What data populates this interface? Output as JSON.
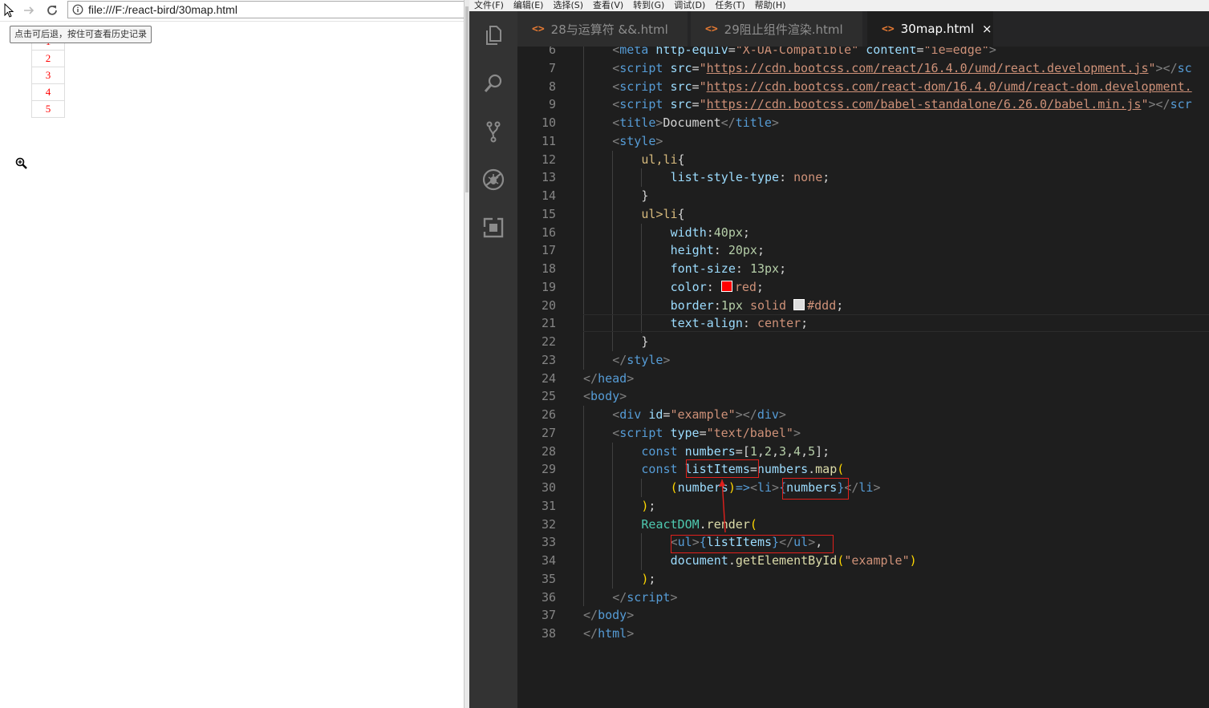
{
  "browser": {
    "url": "file:///F:/react-bird/30map.html",
    "back_tooltip": "点击可后退，按住可查看历史记录",
    "list_items": [
      "1",
      "2",
      "3",
      "4",
      "5"
    ]
  },
  "editor": {
    "menu": [
      "文件(F)",
      "编辑(E)",
      "选择(S)",
      "查看(V)",
      "转到(G)",
      "调试(D)",
      "任务(T)",
      "帮助(H)"
    ],
    "tabs": [
      {
        "label": "28与运算符 &&.html",
        "active": false
      },
      {
        "label": "29阻止组件渲染.html",
        "active": false
      },
      {
        "label": "30map.html",
        "active": true
      }
    ],
    "tab_close": "×",
    "activity_icons": [
      "explorer-icon",
      "search-icon",
      "source-control-icon",
      "debug-icon",
      "extensions-icon"
    ],
    "swatch_colors": {
      "red": "#ff0000",
      "ddd": "#dddddd"
    },
    "lines": [
      {
        "n": "6",
        "indent": 1,
        "tokens": [
          [
            "t-br",
            "<"
          ],
          [
            "t-tag",
            "meta"
          ],
          [
            "t-plain",
            " "
          ],
          [
            "t-attr",
            "http-equiv"
          ],
          [
            "t-plain",
            "="
          ],
          [
            "t-str",
            "\"X-UA-Compatible\""
          ],
          [
            "t-plain",
            " "
          ],
          [
            "t-attr",
            "content"
          ],
          [
            "t-plain",
            "="
          ],
          [
            "t-str",
            "\"ie=edge\""
          ],
          [
            "t-br",
            ">"
          ]
        ]
      },
      {
        "n": "7",
        "indent": 1,
        "tokens": [
          [
            "t-br",
            "<"
          ],
          [
            "t-tag",
            "script"
          ],
          [
            "t-plain",
            " "
          ],
          [
            "t-attr",
            "src"
          ],
          [
            "t-plain",
            "="
          ],
          [
            "t-str",
            "\""
          ],
          [
            "t-url",
            "https://cdn.bootcss.com/react/16.4.0/umd/react.development.js"
          ],
          [
            "t-str",
            "\""
          ],
          [
            "t-br",
            "></"
          ],
          [
            "t-tag",
            "sc"
          ]
        ]
      },
      {
        "n": "8",
        "indent": 1,
        "tokens": [
          [
            "t-br",
            "<"
          ],
          [
            "t-tag",
            "script"
          ],
          [
            "t-plain",
            " "
          ],
          [
            "t-attr",
            "src"
          ],
          [
            "t-plain",
            "="
          ],
          [
            "t-str",
            "\""
          ],
          [
            "t-url",
            "https://cdn.bootcss.com/react-dom/16.4.0/umd/react-dom.development."
          ]
        ]
      },
      {
        "n": "9",
        "indent": 1,
        "tokens": [
          [
            "t-br",
            "<"
          ],
          [
            "t-tag",
            "script"
          ],
          [
            "t-plain",
            " "
          ],
          [
            "t-attr",
            "src"
          ],
          [
            "t-plain",
            "="
          ],
          [
            "t-str",
            "\""
          ],
          [
            "t-url",
            "https://cdn.bootcss.com/babel-standalone/6.26.0/babel.min.js"
          ],
          [
            "t-str",
            "\""
          ],
          [
            "t-br",
            "></"
          ],
          [
            "t-tag",
            "scr"
          ]
        ]
      },
      {
        "n": "10",
        "indent": 1,
        "tokens": [
          [
            "t-br",
            "<"
          ],
          [
            "t-tag",
            "title"
          ],
          [
            "t-br",
            ">"
          ],
          [
            "t-plain",
            "Document"
          ],
          [
            "t-br",
            "</"
          ],
          [
            "t-tag",
            "title"
          ],
          [
            "t-br",
            ">"
          ]
        ]
      },
      {
        "n": "11",
        "indent": 1,
        "tokens": [
          [
            "t-br",
            "<"
          ],
          [
            "t-tag",
            "style"
          ],
          [
            "t-br",
            ">"
          ]
        ]
      },
      {
        "n": "12",
        "indent": 2,
        "tokens": [
          [
            "t-sel",
            "ul,li"
          ],
          [
            "t-plain",
            "{"
          ]
        ]
      },
      {
        "n": "13",
        "indent": 3,
        "tokens": [
          [
            "t-prop",
            "list-style-type"
          ],
          [
            "t-plain",
            ": "
          ],
          [
            "t-val",
            "none"
          ],
          [
            "t-plain",
            ";"
          ]
        ]
      },
      {
        "n": "14",
        "indent": 2,
        "tokens": [
          [
            "t-plain",
            "}"
          ]
        ]
      },
      {
        "n": "15",
        "indent": 2,
        "tokens": [
          [
            "t-sel",
            "ul>li"
          ],
          [
            "t-plain",
            "{"
          ]
        ]
      },
      {
        "n": "16",
        "indent": 3,
        "tokens": [
          [
            "t-prop",
            "width"
          ],
          [
            "t-plain",
            ":"
          ],
          [
            "t-num",
            "40px"
          ],
          [
            "t-plain",
            ";"
          ]
        ]
      },
      {
        "n": "17",
        "indent": 3,
        "tokens": [
          [
            "t-prop",
            "height"
          ],
          [
            "t-plain",
            ": "
          ],
          [
            "t-num",
            "20px"
          ],
          [
            "t-plain",
            ";"
          ]
        ]
      },
      {
        "n": "18",
        "indent": 3,
        "tokens": [
          [
            "t-prop",
            "font-size"
          ],
          [
            "t-plain",
            ": "
          ],
          [
            "t-num",
            "13px"
          ],
          [
            "t-plain",
            ";"
          ]
        ]
      },
      {
        "n": "19",
        "indent": 3,
        "tokens": [
          [
            "t-prop",
            "color"
          ],
          [
            "t-plain",
            ": "
          ],
          [
            "swatch-red",
            ""
          ],
          [
            "t-val",
            "red"
          ],
          [
            "t-plain",
            ";"
          ]
        ]
      },
      {
        "n": "20",
        "indent": 3,
        "tokens": [
          [
            "t-prop",
            "border"
          ],
          [
            "t-plain",
            ":"
          ],
          [
            "t-num",
            "1px"
          ],
          [
            "t-plain",
            " "
          ],
          [
            "t-val",
            "solid"
          ],
          [
            "t-plain",
            " "
          ],
          [
            "swatch-ddd",
            ""
          ],
          [
            "t-val",
            "#ddd"
          ],
          [
            "t-plain",
            ";"
          ]
        ]
      },
      {
        "n": "21",
        "indent": 3,
        "tokens": [
          [
            "t-prop",
            "text-align"
          ],
          [
            "t-plain",
            ": "
          ],
          [
            "t-val",
            "center"
          ],
          [
            "t-plain",
            ";"
          ]
        ]
      },
      {
        "n": "22",
        "indent": 2,
        "tokens": [
          [
            "t-plain",
            "}"
          ]
        ]
      },
      {
        "n": "23",
        "indent": 1,
        "tokens": [
          [
            "t-br",
            "</"
          ],
          [
            "t-tag",
            "style"
          ],
          [
            "t-br",
            ">"
          ]
        ]
      },
      {
        "n": "24",
        "indent": 0,
        "tokens": [
          [
            "t-br",
            "</"
          ],
          [
            "t-tag",
            "head"
          ],
          [
            "t-br",
            ">"
          ]
        ]
      },
      {
        "n": "25",
        "indent": 0,
        "tokens": [
          [
            "t-br",
            "<"
          ],
          [
            "t-tag",
            "body"
          ],
          [
            "t-br",
            ">"
          ]
        ]
      },
      {
        "n": "26",
        "indent": 1,
        "tokens": [
          [
            "t-br",
            "<"
          ],
          [
            "t-tag",
            "div"
          ],
          [
            "t-plain",
            " "
          ],
          [
            "t-attr",
            "id"
          ],
          [
            "t-plain",
            "="
          ],
          [
            "t-str",
            "\"example\""
          ],
          [
            "t-br",
            "></"
          ],
          [
            "t-tag",
            "div"
          ],
          [
            "t-br",
            ">"
          ]
        ]
      },
      {
        "n": "27",
        "indent": 1,
        "tokens": [
          [
            "t-br",
            "<"
          ],
          [
            "t-tag",
            "script"
          ],
          [
            "t-plain",
            " "
          ],
          [
            "t-attr",
            "type"
          ],
          [
            "t-plain",
            "="
          ],
          [
            "t-str",
            "\"text/babel\""
          ],
          [
            "t-br",
            ">"
          ]
        ]
      },
      {
        "n": "28",
        "indent": 2,
        "tokens": [
          [
            "t-kw",
            "const"
          ],
          [
            "t-plain",
            " "
          ],
          [
            "t-var",
            "numbers"
          ],
          [
            "t-plain",
            "=["
          ],
          [
            "t-num",
            "1"
          ],
          [
            "t-plain",
            ","
          ],
          [
            "t-num",
            "2"
          ],
          [
            "t-plain",
            ","
          ],
          [
            "t-num",
            "3"
          ],
          [
            "t-plain",
            ","
          ],
          [
            "t-num",
            "4"
          ],
          [
            "t-plain",
            ","
          ],
          [
            "t-num",
            "5"
          ],
          [
            "t-plain",
            "];"
          ]
        ]
      },
      {
        "n": "29",
        "indent": 2,
        "tokens": [
          [
            "t-kw",
            "const"
          ],
          [
            "t-plain",
            " "
          ],
          [
            "t-var",
            "listItems"
          ],
          [
            "t-plain",
            "="
          ],
          [
            "t-var",
            "numbers"
          ],
          [
            "t-plain",
            "."
          ],
          [
            "t-fn",
            "map"
          ],
          [
            "t-brace",
            "("
          ]
        ]
      },
      {
        "n": "30",
        "indent": 3,
        "tokens": [
          [
            "t-brace",
            "("
          ],
          [
            "t-var",
            "numbers"
          ],
          [
            "t-brace",
            ")"
          ],
          [
            "t-kw",
            "=>"
          ],
          [
            "t-br",
            "<"
          ],
          [
            "t-tag",
            "li"
          ],
          [
            "t-br",
            ">"
          ],
          [
            "t-kw",
            "{"
          ],
          [
            "t-var",
            "numbers"
          ],
          [
            "t-kw",
            "}"
          ],
          [
            "t-br",
            "</"
          ],
          [
            "t-tag",
            "li"
          ],
          [
            "t-br",
            ">"
          ]
        ]
      },
      {
        "n": "31",
        "indent": 2,
        "tokens": [
          [
            "t-brace",
            ")"
          ],
          [
            "t-plain",
            ";"
          ]
        ]
      },
      {
        "n": "32",
        "indent": 2,
        "tokens": [
          [
            "t-cls",
            "ReactDOM"
          ],
          [
            "t-plain",
            "."
          ],
          [
            "t-fn",
            "render"
          ],
          [
            "t-brace",
            "("
          ]
        ]
      },
      {
        "n": "33",
        "indent": 3,
        "tokens": [
          [
            "t-br",
            "<"
          ],
          [
            "t-tag",
            "ul"
          ],
          [
            "t-br",
            ">"
          ],
          [
            "t-kw",
            "{"
          ],
          [
            "t-var",
            "listItems"
          ],
          [
            "t-kw",
            "}"
          ],
          [
            "t-br",
            "</"
          ],
          [
            "t-tag",
            "ul"
          ],
          [
            "t-br",
            ">"
          ],
          [
            "t-plain",
            ","
          ]
        ]
      },
      {
        "n": "34",
        "indent": 3,
        "tokens": [
          [
            "t-var",
            "document"
          ],
          [
            "t-plain",
            "."
          ],
          [
            "t-fn",
            "getElementById"
          ],
          [
            "t-brace",
            "("
          ],
          [
            "t-str",
            "\"example\""
          ],
          [
            "t-brace",
            ")"
          ]
        ]
      },
      {
        "n": "35",
        "indent": 2,
        "tokens": [
          [
            "t-brace",
            ")"
          ],
          [
            "t-plain",
            ";"
          ]
        ]
      },
      {
        "n": "36",
        "indent": 1,
        "tokens": [
          [
            "t-br",
            "</"
          ],
          [
            "t-tag",
            "script"
          ],
          [
            "t-br",
            ">"
          ]
        ]
      },
      {
        "n": "37",
        "indent": 0,
        "tokens": [
          [
            "t-br",
            "</"
          ],
          [
            "t-tag",
            "body"
          ],
          [
            "t-br",
            ">"
          ]
        ]
      },
      {
        "n": "38",
        "indent": 0,
        "tokens": [
          [
            "t-br",
            "</"
          ],
          [
            "t-tag",
            "html"
          ],
          [
            "t-br",
            ">"
          ]
        ]
      }
    ]
  }
}
